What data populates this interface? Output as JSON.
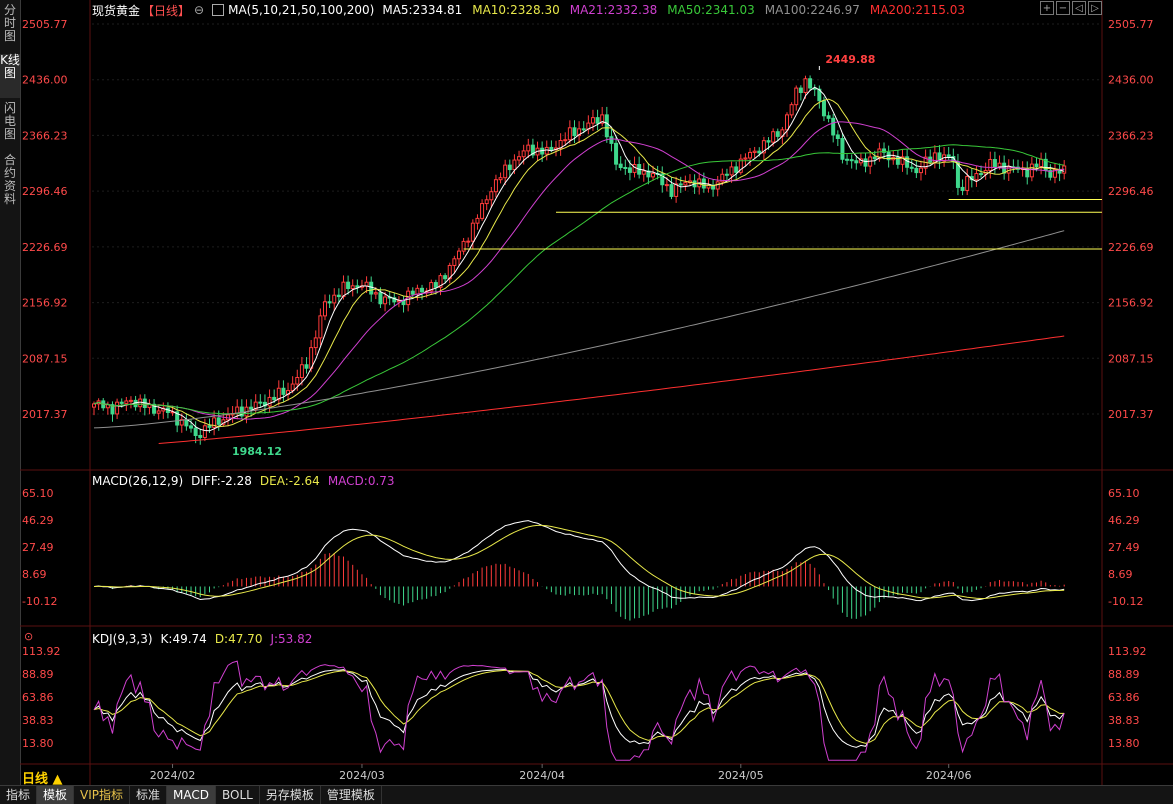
{
  "left_tabs": [
    "分时图",
    "K线图",
    "闪电图",
    "合约资料"
  ],
  "active_left_tab": 1,
  "header": {
    "title": "现货黄金",
    "period_tag": "【日线】",
    "ma_params": "MA(5,10,21,50,100,200)",
    "ma_values": [
      {
        "text": "MA5:2334.81",
        "color": "#ffffff"
      },
      {
        "text": "MA10:2328.30",
        "color": "#e8e84a"
      },
      {
        "text": "MA21:2332.38",
        "color": "#d040d0"
      },
      {
        "text": "MA50:2341.03",
        "color": "#39c839"
      },
      {
        "text": "MA100:2246.97",
        "color": "#909090"
      },
      {
        "text": "MA200:2115.03",
        "color": "#ff3030"
      }
    ]
  },
  "macd_header": {
    "label": "MACD(26,12,9)",
    "diff": "DIFF:-2.28",
    "dea": "DEA:-2.64",
    "macd": "MACD:0.73"
  },
  "kdj_header": {
    "label": "KDJ(9,3,3)",
    "k": "K:49.74",
    "d": "D:47.70",
    "j": "J:53.82"
  },
  "period_label": "日线 ▲",
  "bottom_tabs": [
    "指标",
    "模板",
    "VIP指标",
    "标准",
    "MACD",
    "BOLL",
    "另存模板",
    "管理模板"
  ],
  "colors": {
    "up": "#ff3b3b",
    "down": "#3fd88c",
    "axis_text": "#ff4a4a",
    "grid": "#1e1e1e",
    "support_line": "#ffff55"
  },
  "chart_data": [
    {
      "type": "candlestick",
      "title": "现货黄金",
      "y_ticks": [
        "2505.77",
        "2436.00",
        "2366.23",
        "2296.46",
        "2226.69",
        "2156.92",
        "2087.15",
        "2017.37"
      ],
      "ylim": [
        1967,
        2505.77
      ],
      "x_ticks": [
        "2024/02",
        "2024/03",
        "2024/04",
        "2024/05",
        "2024/06"
      ],
      "annotations": [
        {
          "text": "2449.88",
          "kind": "high"
        },
        {
          "text": "1984.12",
          "kind": "low"
        }
      ],
      "horizontal_levels": [
        2286.0,
        2270.0,
        2224.0
      ],
      "close_anchors": [
        [
          0,
          2030
        ],
        [
          4,
          2025
        ],
        [
          8,
          2035
        ],
        [
          12,
          2025
        ],
        [
          16,
          2020
        ],
        [
          20,
          2003
        ],
        [
          22,
          1990
        ],
        [
          25,
          2003
        ],
        [
          30,
          2018
        ],
        [
          36,
          2030
        ],
        [
          42,
          2048
        ],
        [
          46,
          2080
        ],
        [
          50,
          2155
        ],
        [
          54,
          2175
        ],
        [
          58,
          2180
        ],
        [
          62,
          2162
        ],
        [
          66,
          2158
        ],
        [
          70,
          2172
        ],
        [
          74,
          2178
        ],
        [
          78,
          2210
        ],
        [
          82,
          2252
        ],
        [
          86,
          2300
        ],
        [
          90,
          2330
        ],
        [
          94,
          2350
        ],
        [
          98,
          2345
        ],
        [
          103,
          2368
        ],
        [
          107,
          2380
        ],
        [
          110,
          2390
        ],
        [
          113,
          2330
        ],
        [
          117,
          2322
        ],
        [
          121,
          2318
        ],
        [
          125,
          2297
        ],
        [
          129,
          2310
        ],
        [
          133,
          2300
        ],
        [
          137,
          2318
        ],
        [
          141,
          2338
        ],
        [
          145,
          2355
        ],
        [
          149,
          2375
        ],
        [
          152,
          2420
        ],
        [
          154,
          2435
        ],
        [
          156,
          2420
        ],
        [
          159,
          2385
        ],
        [
          162,
          2340
        ],
        [
          166,
          2330
        ],
        [
          170,
          2345
        ],
        [
          174,
          2335
        ],
        [
          178,
          2322
        ],
        [
          182,
          2342
        ],
        [
          186,
          2335
        ],
        [
          187,
          2300
        ],
        [
          190,
          2312
        ],
        [
          194,
          2330
        ],
        [
          198,
          2325
        ],
        [
          202,
          2322
        ],
        [
          205,
          2332
        ],
        [
          207,
          2318
        ],
        [
          210,
          2322
        ]
      ],
      "moving_averages": [
        {
          "name": "MA5",
          "value": 2334.81
        },
        {
          "name": "MA10",
          "value": 2328.3
        },
        {
          "name": "MA21",
          "value": 2332.38
        },
        {
          "name": "MA50",
          "value": 2341.03
        },
        {
          "name": "MA100",
          "value": 2246.97
        },
        {
          "name": "MA200",
          "value": 2115.03
        }
      ]
    },
    {
      "type": "bar",
      "title": "MACD(26,12,9)",
      "y_ticks": [
        "65.10",
        "46.29",
        "27.49",
        "8.69",
        "-10.12"
      ],
      "ylim": [
        -28,
        72
      ]
    },
    {
      "type": "line",
      "title": "KDJ(9,3,3)",
      "y_ticks": [
        "113.92",
        "88.89",
        "63.86",
        "38.83",
        "13.80"
      ],
      "ylim": [
        -5,
        125
      ]
    }
  ]
}
